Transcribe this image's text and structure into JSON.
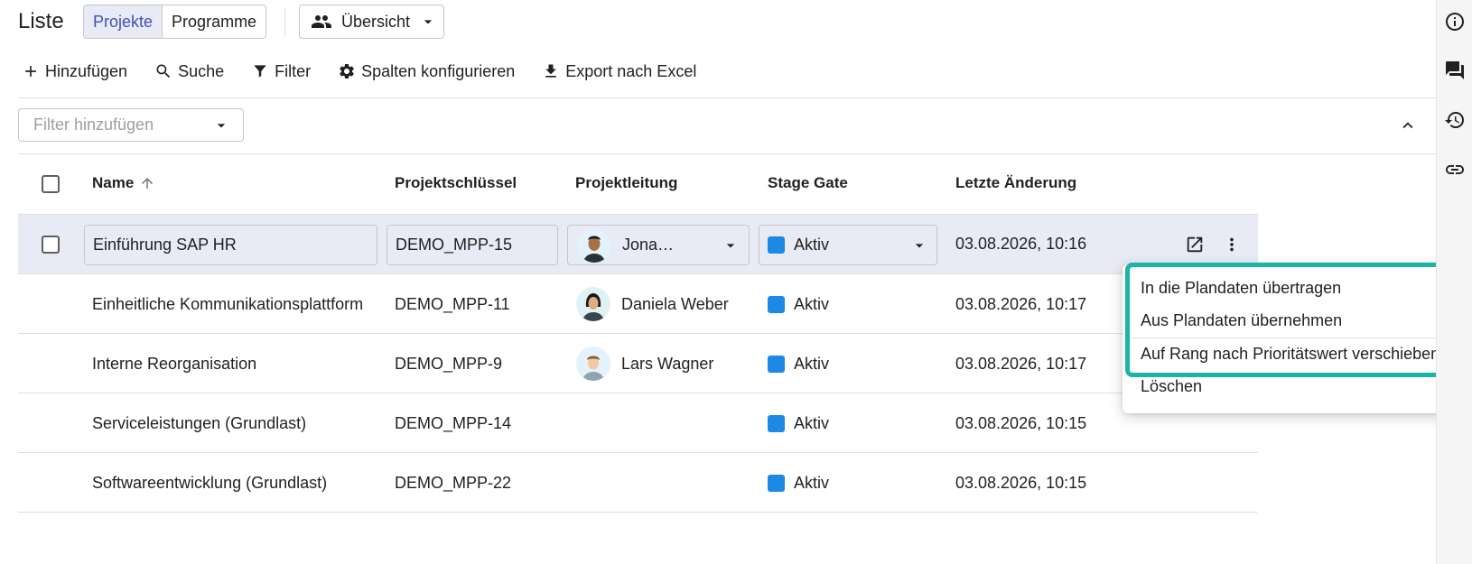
{
  "header": {
    "title": "Liste",
    "tabs": [
      {
        "label": "Projekte",
        "active": true
      },
      {
        "label": "Programme",
        "active": false
      }
    ],
    "view_label": "Übersicht"
  },
  "toolbar": {
    "add_label": "Hinzufügen",
    "search_label": "Suche",
    "filter_label": "Filter",
    "columns_label": "Spalten konfigurieren",
    "export_label": "Export nach Excel"
  },
  "filter": {
    "placeholder": "Filter hinzufügen"
  },
  "table": {
    "columns": {
      "name": "Name",
      "key": "Projektschlüssel",
      "lead": "Projektleitung",
      "stage": "Stage Gate",
      "changed": "Letzte Änderung"
    },
    "rows": [
      {
        "name": "Einführung SAP HR",
        "key": "DEMO_MPP-15",
        "lead": "Jona…",
        "stage": "Aktiv",
        "changed": "03.08.2026, 10:16",
        "selected": true
      },
      {
        "name": "Einheitliche Kommunikationsplattform",
        "key": "DEMO_MPP-11",
        "lead": "Daniela Weber",
        "stage": "Aktiv",
        "changed": "03.08.2026, 10:17"
      },
      {
        "name": "Interne Reorganisation",
        "key": "DEMO_MPP-9",
        "lead": "Lars Wagner",
        "stage": "Aktiv",
        "changed": "03.08.2026, 10:17"
      },
      {
        "name": "Serviceleistungen (Grundlast)",
        "key": "DEMO_MPP-14",
        "lead": "",
        "stage": "Aktiv",
        "changed": "03.08.2026, 10:15"
      },
      {
        "name": "Softwareentwicklung (Grundlast)",
        "key": "DEMO_MPP-22",
        "lead": "",
        "stage": "Aktiv",
        "changed": "03.08.2026, 10:15"
      }
    ]
  },
  "context_menu": {
    "items": [
      "In die Plandaten übertragen",
      "Aus Plandaten übernehmen",
      "Auf Rang nach Prioritätswert verschieben",
      "Löschen"
    ]
  },
  "colors": {
    "accent": "#3f51b5",
    "selected_row": "#e8eaf6",
    "stage_active": "#1e88e5",
    "highlight": "#19b5a5"
  },
  "icons": {
    "sidebar": [
      "info-icon",
      "comments-icon",
      "history-icon",
      "link-icon"
    ]
  }
}
